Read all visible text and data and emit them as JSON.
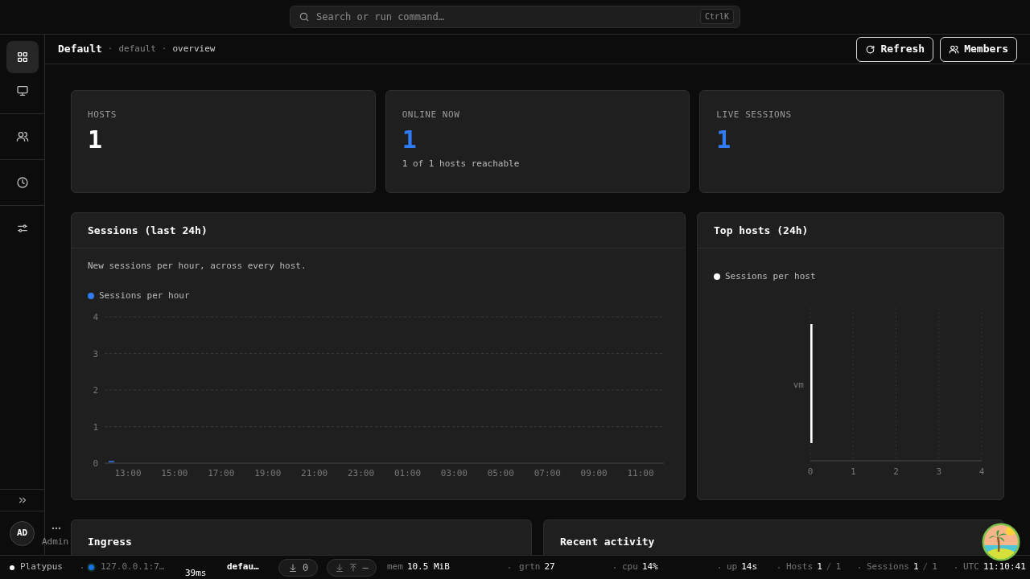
{
  "search": {
    "placeholder": "Search or run command…",
    "shortcut": "CtrlK"
  },
  "sidebar": {
    "items": [
      {
        "selected": true
      },
      {
        "selected": false
      },
      {
        "selected": false
      },
      {
        "selected": false
      },
      {
        "selected": false
      }
    ]
  },
  "user": {
    "initials": "AD",
    "role": "Admin"
  },
  "breadcrumb": {
    "title": "Default",
    "separator": "·",
    "workspace": "default",
    "page": "overview"
  },
  "actions": [
    {
      "label": "Refresh",
      "kind": "refresh"
    },
    {
      "label": "Members",
      "kind": "members"
    }
  ],
  "stats": [
    {
      "label": "HOSTS",
      "value": "1",
      "color": "#ffffff"
    },
    {
      "label": "ONLINE NOW",
      "value": "1",
      "color": "#2f7cf6",
      "note": "1 of 1 hosts reachable"
    },
    {
      "label": "LIVE SESSIONS",
      "value": "1",
      "color": "#2f7cf6"
    }
  ],
  "sessions_panel": {
    "title": "Sessions (last 24h)",
    "description": "New sessions per hour, across every host.",
    "chart_data": {
      "type": "bar",
      "categories": [
        "13:00",
        "15:00",
        "17:00",
        "19:00",
        "21:00",
        "23:00",
        "01:00",
        "03:00",
        "05:00",
        "07:00",
        "09:00",
        "11:00"
      ],
      "series": [
        {
          "name": "Sessions per hour",
          "color": "#2f7cf6",
          "values": [
            0,
            0,
            0,
            0,
            0,
            0,
            0,
            0,
            0,
            0,
            0,
            0
          ]
        }
      ],
      "ylim": [
        0,
        4
      ],
      "yticks": [
        0,
        1,
        2,
        3,
        4
      ],
      "grid": true
    }
  },
  "top_hosts_panel": {
    "title": "Top hosts (24h)",
    "chart_data": {
      "type": "bar",
      "orientation": "horizontal",
      "categories": [
        "vm"
      ],
      "series": [
        {
          "name": "Sessions per host",
          "color": "#ffffff",
          "values": [
            0.05
          ]
        }
      ],
      "xlim": [
        0,
        4
      ],
      "xticks": [
        0,
        1,
        2,
        3,
        4
      ],
      "grid": true
    }
  },
  "bottom_panels": [
    {
      "title": "Ingress"
    },
    {
      "title": "Recent activity"
    }
  ],
  "status_bar": {
    "app": "Platypus",
    "host": "127.0.0.1:7…",
    "latency": "39ms",
    "workspace": "defau…",
    "downloads": "0",
    "transfer": "–",
    "metrics": [
      {
        "label": "mem",
        "value": "10.5 MiB"
      },
      {
        "label": "grtn",
        "value": "27"
      },
      {
        "label": "cpu",
        "value": "14%"
      },
      {
        "label": "up",
        "value": "14s"
      }
    ],
    "counters": [
      {
        "label": "Hosts",
        "value": "1",
        "divider": "/",
        "total": "1"
      },
      {
        "label": "Sessions",
        "value": "1",
        "divider": "/",
        "total": "1"
      }
    ],
    "clock": {
      "label": "UTC",
      "value": "11:10:41"
    }
  }
}
